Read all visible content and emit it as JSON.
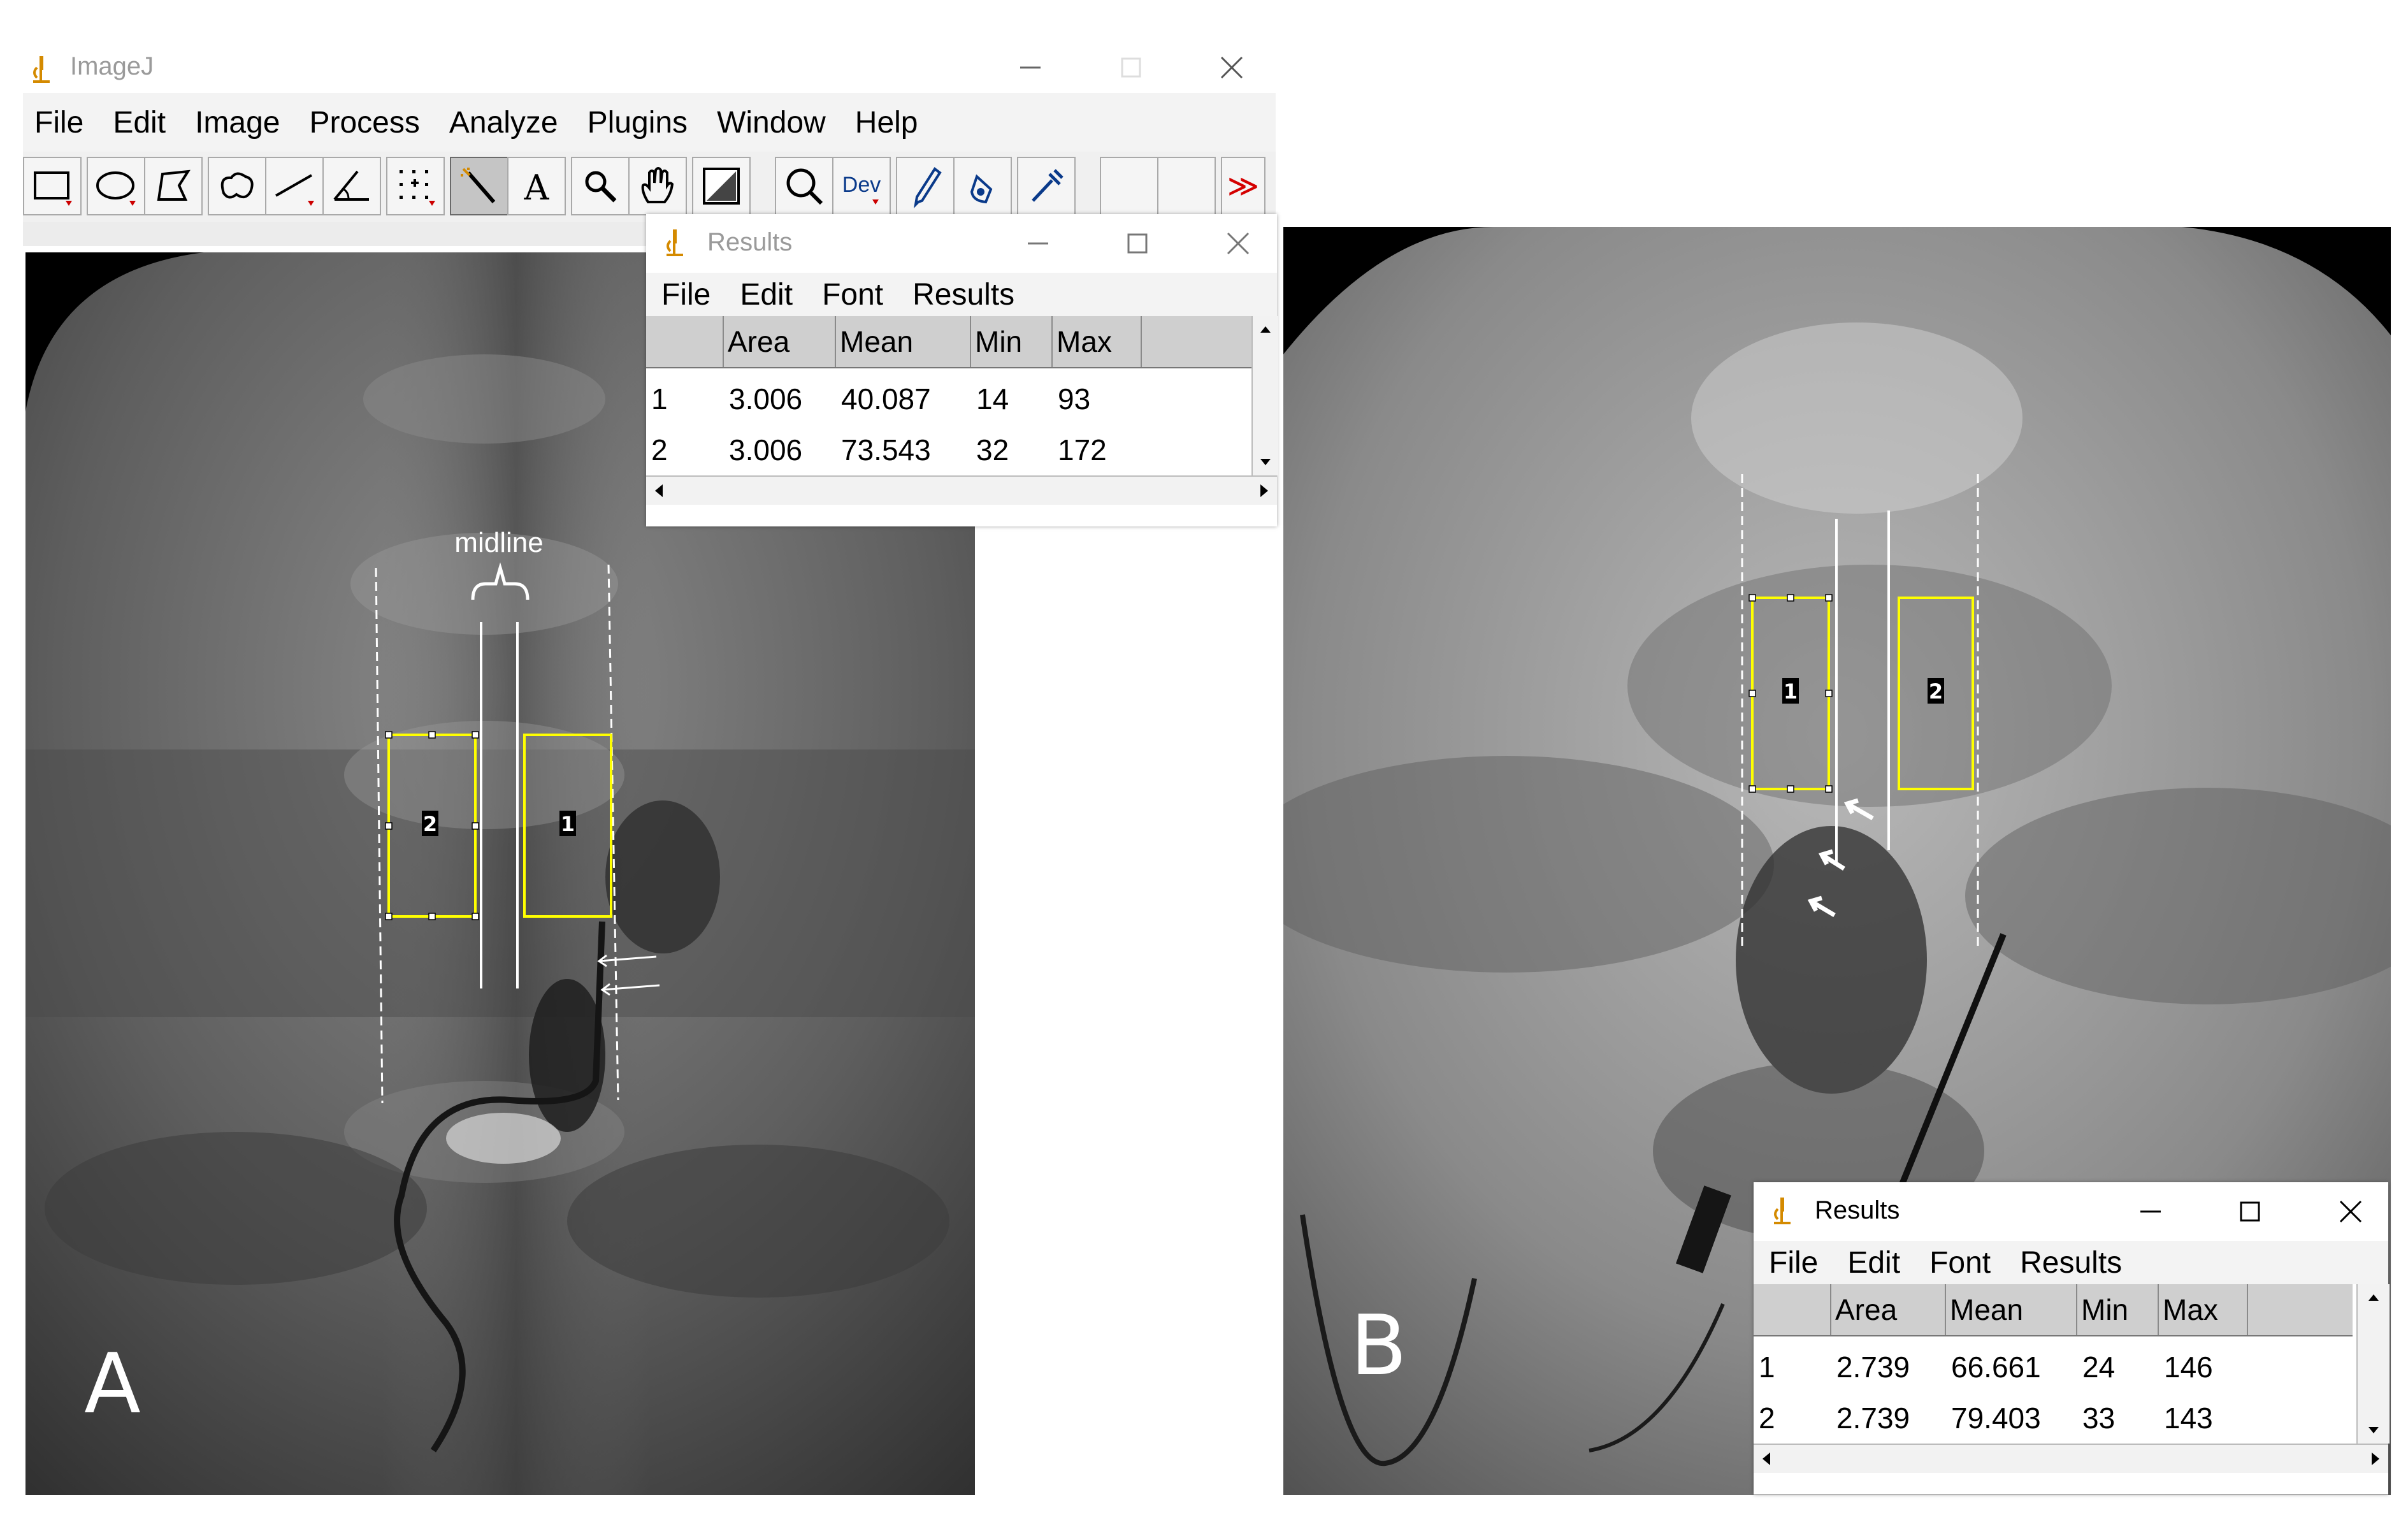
{
  "main_window": {
    "title": "ImageJ",
    "menu": [
      "File",
      "Edit",
      "Image",
      "Process",
      "Analyze",
      "Plugins",
      "Window",
      "Help"
    ],
    "tools": [
      {
        "name": "rectangle-tool-icon"
      },
      {
        "name": "oval-tool-icon"
      },
      {
        "name": "polygon-tool-icon"
      },
      {
        "name": "freehand-tool-icon"
      },
      {
        "name": "line-tool-icon"
      },
      {
        "name": "angle-tool-icon"
      },
      {
        "name": "multipoint-tool-icon"
      },
      {
        "name": "wand-tool-icon",
        "selected": true
      },
      {
        "name": "text-tool-icon",
        "label": "A"
      },
      {
        "name": "magnifier-tool-icon"
      },
      {
        "name": "hand-tool-icon"
      },
      {
        "name": "color-picker-tool-icon"
      },
      {
        "name": "zoom-tool-icon"
      },
      {
        "name": "developer-menu-icon",
        "label": "Dev"
      },
      {
        "name": "pencil-tool-icon"
      },
      {
        "name": "brush-tool-icon"
      },
      {
        "name": "pipette-tool-icon"
      },
      {
        "name": "empty-tool-slot"
      },
      {
        "name": "empty-tool-slot"
      },
      {
        "name": "more-tools-icon",
        "label": "≫"
      }
    ]
  },
  "results_a": {
    "title": "Results",
    "menu": [
      "File",
      "Edit",
      "Font",
      "Results"
    ],
    "columns": [
      "",
      "Area",
      "Mean",
      "Min",
      "Max"
    ],
    "rows": [
      [
        "1",
        "3.006",
        "40.087",
        "14",
        "93"
      ],
      [
        "2",
        "3.006",
        "73.543",
        "32",
        "172"
      ]
    ]
  },
  "results_b": {
    "title": "Results",
    "menu": [
      "File",
      "Edit",
      "Font",
      "Results"
    ],
    "columns": [
      "",
      "Area",
      "Mean",
      "Min",
      "Max"
    ],
    "rows": [
      [
        "1",
        "2.739",
        "66.661",
        "24",
        "146"
      ],
      [
        "2",
        "2.739",
        "79.403",
        "33",
        "143"
      ]
    ]
  },
  "panel_a": {
    "letter": "A",
    "midline_label": "midline",
    "roi_labels": [
      "2",
      "1"
    ]
  },
  "panel_b": {
    "letter": "B",
    "roi_labels": [
      "1",
      "2"
    ]
  },
  "colors": {
    "roi_yellow": "#ffff00",
    "more_tools_red": "#d40000",
    "app_icon_orange": "#d48a00"
  }
}
